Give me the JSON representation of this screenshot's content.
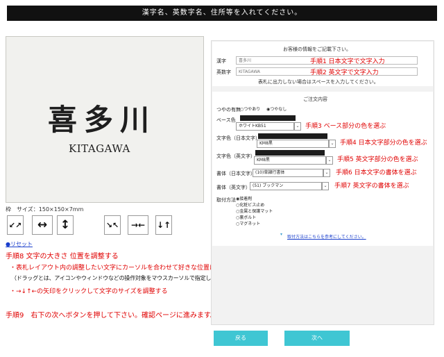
{
  "header": {
    "title": "漢字名、英数字名、住所等を入れてください。"
  },
  "preview": {
    "kanji": "喜多川",
    "roman": "KITAGAWA"
  },
  "size_label": "枠　サイズ：150×150×7mm",
  "controls": [
    "↙↗",
    "↔",
    "↕",
    "↘↖",
    "→←",
    "↓↑"
  ],
  "reset_label": "●リセット",
  "notes": {
    "step8": "手順8 文字の大きさ 位置を調整する",
    "step8_a": "・表札レイアウト内の調整したい文字にカーソルを合わせて好きな位置にドラッグしてください。",
    "step8_b": "（ドラッグとは、アイコンやウィンドウなどの操作対象をマウスカーソルで指定し、マウスボタンを押した状態のままカーソルを移動させる操作のこと）",
    "step8_c": "・→↓↑←の矢印をクリックして文字のサイズを調整する",
    "step9": "手順9　右下の次へボタンを押して下さい。確認ページに進みます。"
  },
  "customer": {
    "heading": "お客様の情報をご記載下さい。",
    "kanji_label": "漢字",
    "kanji_placeholder": "喜多川",
    "eng_label": "英数字",
    "eng_placeholder": "KITAGAWA",
    "hint": "表札に出力しない場合はスペースを入力してください。",
    "step1": "手順1 日本文字で文字入力",
    "step2": "手順2 英文字で文字入力"
  },
  "order": {
    "heading": "ご注文内容",
    "gloss_label": "つやの有無",
    "gloss_options": [
      "○つやあり",
      "◉つやなし"
    ],
    "base_label": "ベース色",
    "base_value": "ホワイトKB51",
    "step3": "手順3 ベース部分の色を選ぶ",
    "jp_color_label": "文字色（日本文字）",
    "jp_color_value": "KM8黒",
    "step4": "手順4 日本文字部分の色を選ぶ",
    "en_color_label": "文字色（英文字）",
    "en_color_value": "KM8黒",
    "step5": "手順5 英文字部分の色を選ぶ",
    "jp_font_label": "書体（日本文字）",
    "jp_font_value": "(10)草隷行書体",
    "step6": "手順6 日本文字の書体を選ぶ",
    "en_font_label": "書体（英文字）",
    "en_font_value": "(51) ブックマン",
    "step7": "手順7 英文字の書体を選ぶ",
    "mount_label": "取付方法",
    "mount_options": [
      "◉接着剤",
      "○化粧ビス止め",
      "○金属と保護マット",
      "○裏ボルト",
      "○マグネット"
    ],
    "mount_link": "取付方法はこちらを参考にしてください。"
  },
  "buttons": {
    "back": "戻る",
    "next": "次へ"
  },
  "colors": {
    "accent_red": "#e00000",
    "button": "#3fc6d3",
    "swatch": "#1c1c1c"
  }
}
